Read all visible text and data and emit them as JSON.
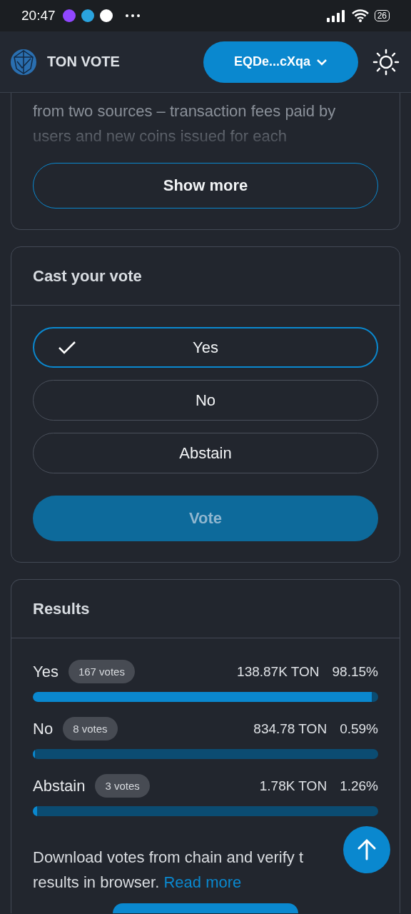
{
  "status_bar": {
    "time": "20:47",
    "battery": "26"
  },
  "header": {
    "title": "TON VOTE",
    "wallet": "EQDe...cXqa"
  },
  "description": {
    "lines": [
      "from two sources – transaction fees paid by",
      "users and new coins issued for each"
    ],
    "show_more": "Show more"
  },
  "vote": {
    "title": "Cast your vote",
    "options": [
      {
        "label": "Yes",
        "selected": true
      },
      {
        "label": "No",
        "selected": false
      },
      {
        "label": "Abstain",
        "selected": false
      }
    ],
    "button": {
      "label": "Vote",
      "disabled": true
    }
  },
  "results": {
    "title": "Results",
    "rows": [
      {
        "label": "Yes",
        "votes": "167 votes",
        "amount": "138.87K TON",
        "percent": "98.15%",
        "level": 0.9815
      },
      {
        "label": "No",
        "votes": "8 votes",
        "amount": "834.78 TON",
        "percent": "0.59%",
        "level": 0.0059
      },
      {
        "label": "Abstain",
        "votes": "3 votes",
        "amount": "1.78K TON",
        "percent": "1.26%",
        "level": 0.0126
      }
    ],
    "note_lines": [
      "Download votes from chain and verify t",
      "results in browser."
    ],
    "link": "Read more"
  }
}
